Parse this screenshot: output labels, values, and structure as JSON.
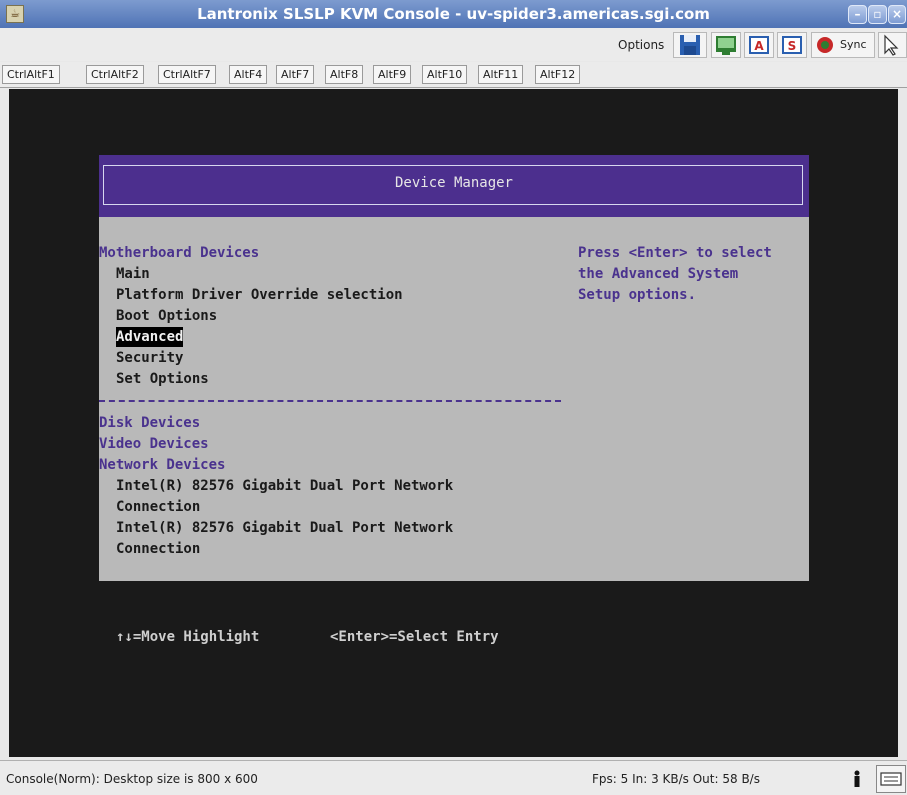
{
  "window": {
    "title": "Lantronix SLSLP KVM Console - uv-spider3.americas.sgi.com",
    "buttons": [
      "minimize-icon",
      "maximize-icon",
      "close-icon"
    ]
  },
  "toolbar": {
    "options_label": "Options",
    "sync_label": "Sync",
    "icons": [
      "save-icon",
      "monitor-icon",
      "auto-adjust-icon",
      "scale-icon",
      "sync-icon",
      "pointer-icon"
    ]
  },
  "hotkeys": [
    "CtrlAltF1",
    "CtrlAltF2",
    "CtrlAltF7",
    "AltF4",
    "AltF7",
    "AltF8",
    "AltF9",
    "AltF10",
    "AltF11",
    "AltF12"
  ],
  "console": {
    "header_title": "Device Manager",
    "sections": {
      "motherboard": "Motherboard Devices",
      "disk": "Disk Devices",
      "video": "Video Devices",
      "network": "Network Devices"
    },
    "motherboard_items": [
      "Main",
      "Platform Driver Override selection",
      "Boot Options",
      "Advanced",
      "Security",
      "Set Options"
    ],
    "selected_item": "Advanced",
    "network_items": [
      "Intel(R) 82576 Gigabit Dual Port Network",
      "Connection",
      "Intel(R) 82576 Gigabit Dual Port Network",
      "Connection"
    ],
    "help_lines": [
      "Press <Enter> to select",
      "the Advanced System",
      "Setup options."
    ],
    "footer": {
      "move": "↑↓=Move Highlight",
      "select": "<Enter>=Select Entry"
    }
  },
  "status": {
    "left": "Console(Norm): Desktop size is 800 x 600",
    "right": "Fps: 5 In: 3 KB/s Out: 58 B/s"
  }
}
